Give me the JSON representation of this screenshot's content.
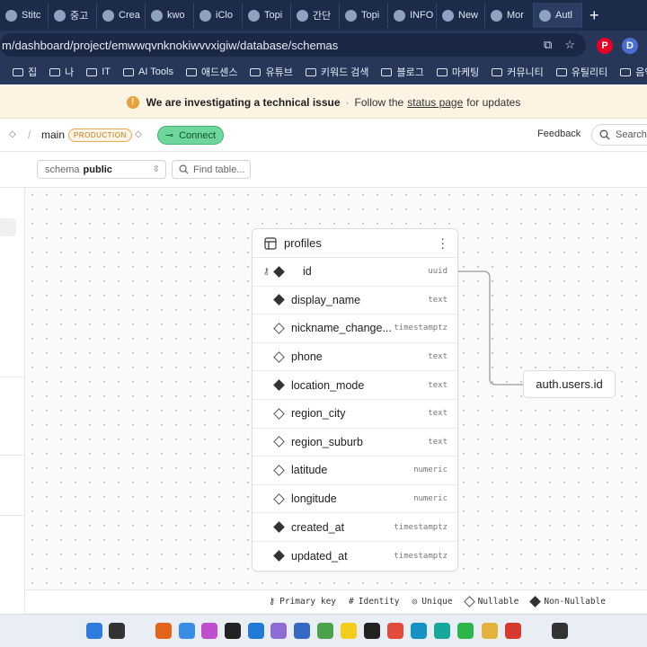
{
  "browser": {
    "tabs": [
      {
        "label": "Stitc",
        "icon": "stitch-icon"
      },
      {
        "label": "중고",
        "icon": "openai-icon"
      },
      {
        "label": "Crea",
        "icon": "chrome-icon"
      },
      {
        "label": "kwo",
        "icon": "github-icon"
      },
      {
        "label": "iClo",
        "icon": "note-icon"
      },
      {
        "label": "Topi",
        "icon": "topic-icon"
      },
      {
        "label": "간단",
        "icon": "chrome-icon"
      },
      {
        "label": "Topi",
        "icon": "topic-icon"
      },
      {
        "label": "INFO",
        "icon": "chrome-icon"
      },
      {
        "label": "New",
        "icon": "chrome-icon"
      },
      {
        "label": "Mor",
        "icon": "chrome-icon"
      },
      {
        "label": "Autl",
        "icon": "supabase-icon"
      }
    ],
    "new_tab": "+",
    "url": "m/dashboard/project/emwwqvnknokiwvvxigiw/database/schemas",
    "profile_letter": "D",
    "bookmarks": [
      "집",
      "나",
      "IT",
      "AI Tools",
      "애드센스",
      "유튜브",
      "키워드 검색",
      "블로그",
      "마케팅",
      "커뮤니티",
      "유틸리티",
      "음악"
    ]
  },
  "banner": {
    "strong": "We are investigating a technical issue",
    "middle": "Follow the",
    "link": "status page",
    "end": "for updates"
  },
  "header": {
    "branch": "main",
    "env_badge": "PRODUCTION",
    "connect": "Connect",
    "feedback": "Feedback",
    "search": "Search..."
  },
  "toolbar": {
    "schema_label": "schema",
    "schema_value": "public",
    "find_placeholder": "Find table..."
  },
  "table": {
    "name": "profiles",
    "columns": [
      {
        "name": "id",
        "type": "uuid",
        "primary": true,
        "nullable": false
      },
      {
        "name": "display_name",
        "type": "text",
        "primary": false,
        "nullable": false
      },
      {
        "name": "nickname_change...",
        "type": "timestamptz",
        "primary": false,
        "nullable": true
      },
      {
        "name": "phone",
        "type": "text",
        "primary": false,
        "nullable": true
      },
      {
        "name": "location_mode",
        "type": "text",
        "primary": false,
        "nullable": false
      },
      {
        "name": "region_city",
        "type": "text",
        "primary": false,
        "nullable": true
      },
      {
        "name": "region_suburb",
        "type": "text",
        "primary": false,
        "nullable": true
      },
      {
        "name": "latitude",
        "type": "numeric",
        "primary": false,
        "nullable": true
      },
      {
        "name": "longitude",
        "type": "numeric",
        "primary": false,
        "nullable": true
      },
      {
        "name": "created_at",
        "type": "timestamptz",
        "primary": false,
        "nullable": false
      },
      {
        "name": "updated_at",
        "type": "timestamptz",
        "primary": false,
        "nullable": false
      }
    ]
  },
  "relation": {
    "target": "auth.users.id"
  },
  "legend": {
    "primary_key": "Primary key",
    "identity": "Identity",
    "unique": "Unique",
    "nullable": "Nullable",
    "non_nullable": "Non-Nullable"
  },
  "colors": {
    "connect_green": "#6ed69a",
    "badge_orange": "#e8a94f",
    "browser_dark": "#1c2b4a"
  }
}
